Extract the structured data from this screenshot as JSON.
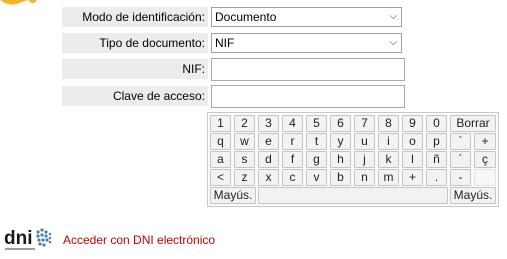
{
  "form": {
    "mode_label": "Modo de identificación:",
    "mode_value": "Documento",
    "doctype_label": "Tipo de documento:",
    "doctype_value": "NIF",
    "nif_label": "NIF:",
    "nif_value": "",
    "password_label": "Clave de acceso:",
    "password_value": ""
  },
  "keyboard": {
    "row1": [
      "1",
      "2",
      "3",
      "4",
      "5",
      "6",
      "7",
      "8",
      "9",
      "0"
    ],
    "delete_label": "Borrar",
    "row2": [
      "q",
      "w",
      "e",
      "r",
      "t",
      "y",
      "u",
      "i",
      "o",
      "p",
      "`",
      "+"
    ],
    "row3": [
      "a",
      "s",
      "d",
      "f",
      "g",
      "h",
      "j",
      "k",
      "l",
      "ñ",
      "´",
      "ç"
    ],
    "row4": [
      "<",
      "z",
      "x",
      "c",
      "v",
      "b",
      "n",
      "m",
      "+",
      ".",
      "-",
      ""
    ],
    "shift_left": "Mayús.",
    "shift_right": "Mayús."
  },
  "footer": {
    "dni_logo_text": "dni",
    "link_text": "Acceder con DNI electrónico"
  },
  "colors": {
    "link": "#c00000",
    "label_bg": "#ececec"
  }
}
